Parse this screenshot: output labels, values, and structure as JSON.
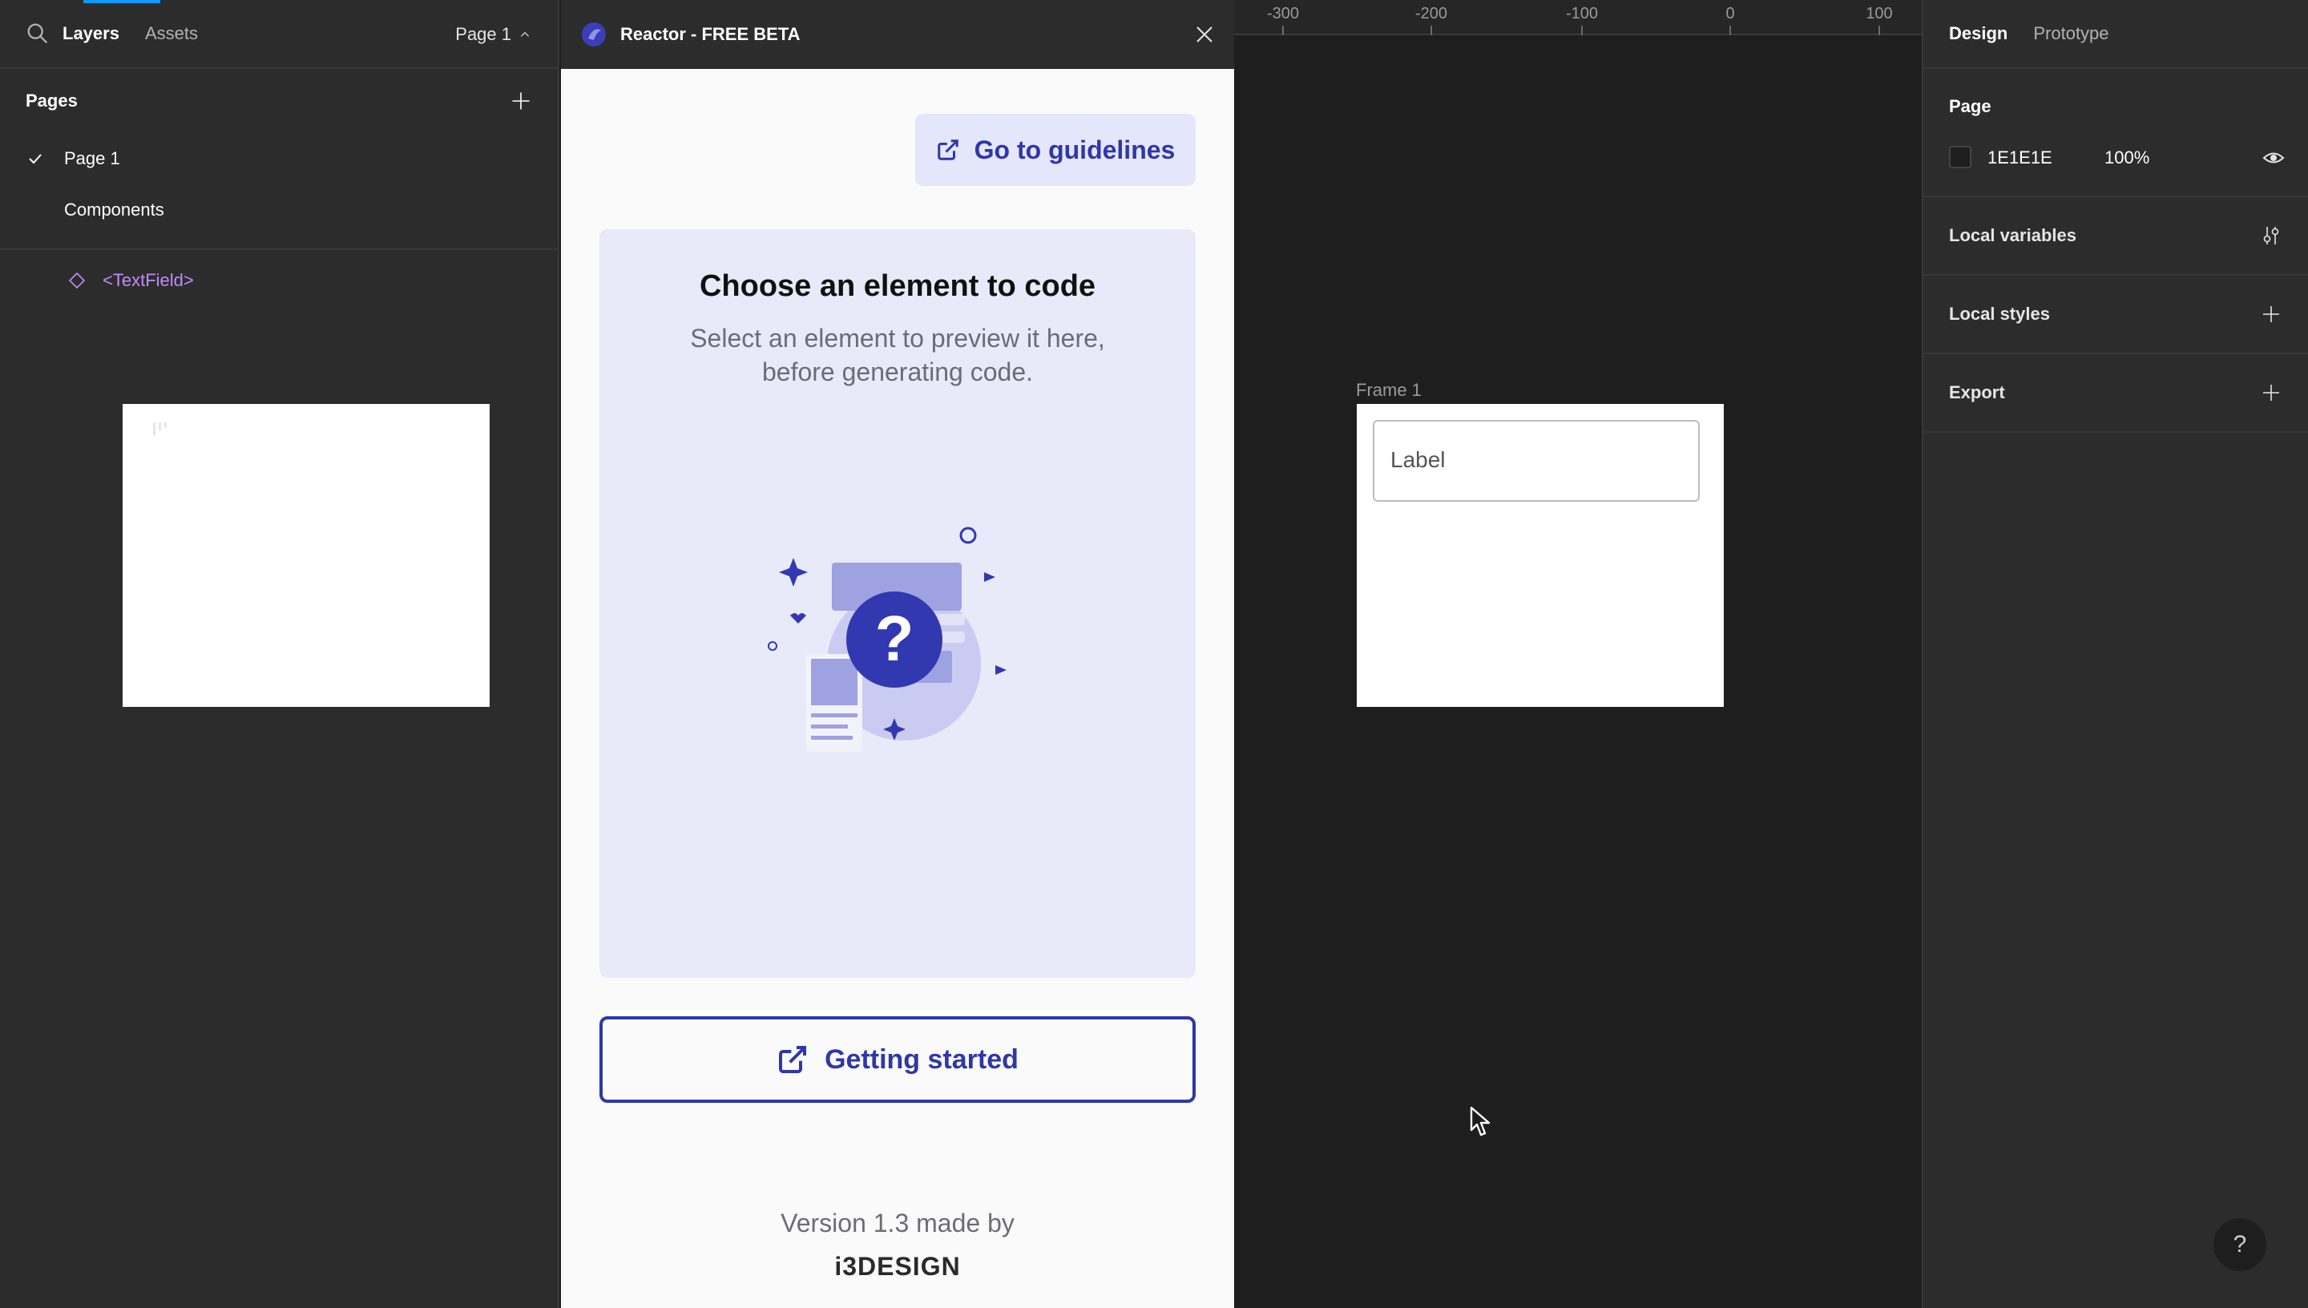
{
  "left_panel": {
    "tabs": {
      "layers": "Layers",
      "assets": "Assets"
    },
    "page_switcher": "Page 1",
    "pages_title": "Pages",
    "pages": [
      "Page 1",
      "Components"
    ],
    "layers": {
      "frame": "Frame 1",
      "component": "<TextField>"
    }
  },
  "plugin": {
    "title": "Reactor - FREE BETA",
    "guidelines_button": "Go to guidelines",
    "preview_title": "Choose an element to code",
    "preview_subtitle": "Select an element to preview it here, before generating code.",
    "getting_started_button": "Getting started",
    "version_text": "Version 1.3 made by",
    "brand": "i3DESIGN",
    "accent_color": "#2f37a8",
    "card_color": "#e8eafa"
  },
  "canvas": {
    "ruler_ticks": [
      "-300",
      "-200",
      "-100",
      "0",
      "100"
    ],
    "frame_label": "Frame 1",
    "textfield_label": "Label"
  },
  "right_panel": {
    "tabs": {
      "design": "Design",
      "prototype": "Prototype"
    },
    "page_section": {
      "title": "Page",
      "color_hex": "1E1E1E",
      "opacity": "100%"
    },
    "sections": [
      "Local variables",
      "Local styles",
      "Export"
    ],
    "help": "?"
  }
}
